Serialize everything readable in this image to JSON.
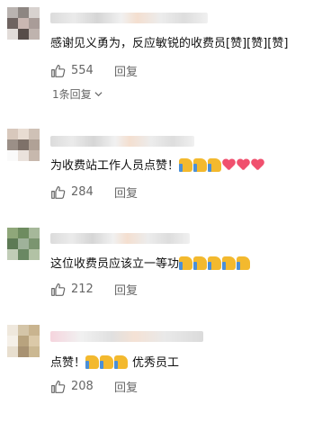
{
  "comments": [
    {
      "text": "感谢见义勇为，反应敏锐的收费员[赞][赞][赞]",
      "emojis": [],
      "likes": "554",
      "reply_label": "回复",
      "replies_label": "1条回复",
      "avatar_colors": [
        "#b9b3b0",
        "#8d8682",
        "#d8d2cf",
        "#6e6360",
        "#c9b7b2",
        "#a99c98",
        "#e2dcd9",
        "#574c49",
        "#bfb3ae"
      ]
    },
    {
      "text": "为收费站工作人员点赞！",
      "emojis": [
        "thumb",
        "thumb",
        "thumb",
        "heart",
        "heart",
        "heart"
      ],
      "likes": "284",
      "reply_label": "回复",
      "avatar_colors": [
        "#d8c8bc",
        "#e8dcd2",
        "#cfc1b6",
        "#9b8f87",
        "#7e7169",
        "#b0a196",
        "#fafafa",
        "#eae2dc",
        "#c7b8ad"
      ]
    },
    {
      "text": "这位收费员应该立一等功",
      "emojis": [
        "thumb",
        "thumb",
        "thumb",
        "thumb",
        "thumb"
      ],
      "likes": "212",
      "reply_label": "回复",
      "avatar_colors": [
        "#8fa77a",
        "#6e8c60",
        "#a6b89a",
        "#5d7a55",
        "#9fb29a",
        "#7b9570",
        "#c1cdb7",
        "#6a8863",
        "#b2c2a5"
      ]
    },
    {
      "text": "点赞！",
      "emojis": [
        "thumb",
        "thumb",
        "thumb"
      ],
      "text_after": "优秀员工",
      "likes": "208",
      "reply_label": "回复",
      "avatar_colors": [
        "#efe8dd",
        "#d4c5a8",
        "#c9b48f",
        "#f5f0e8",
        "#b8a37e",
        "#dbc9a8",
        "#e8dfcf",
        "#a89272",
        "#cbb892"
      ]
    }
  ],
  "icons": {
    "like": "thumbs-up-outline-icon",
    "expand": "chevron-down-icon"
  },
  "colors": {
    "text": "#111111",
    "meta": "#666666",
    "thumb_emoji": "#f3b92e",
    "heart_emoji": "#f0506e"
  }
}
